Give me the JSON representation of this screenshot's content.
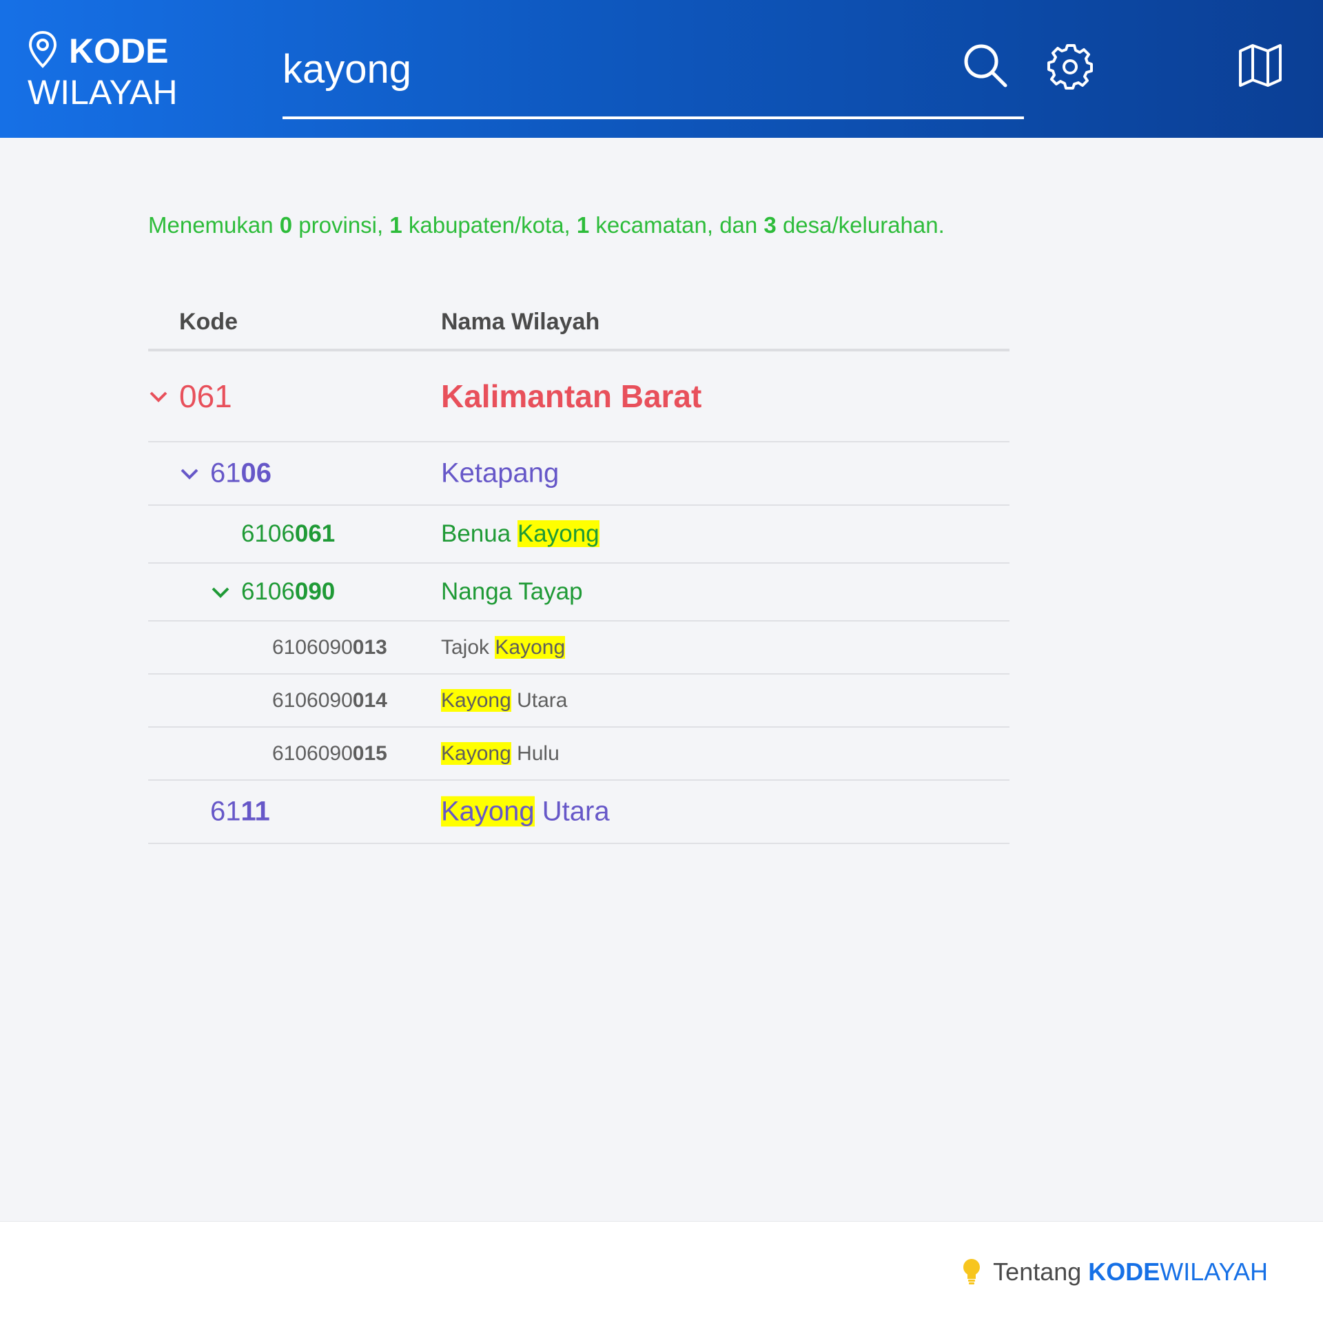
{
  "header": {
    "logo_top": "KODE",
    "logo_bottom": "WILAYAH",
    "search_value": "kayong",
    "icons": {
      "pin": "map-pin-icon",
      "search": "search-icon",
      "settings": "gear-icon",
      "map": "map-icon"
    }
  },
  "summary": {
    "prefix": "Menemukan ",
    "provinsi_count": "0",
    "provinsi_label": " provinsi, ",
    "kabupaten_count": "1",
    "kabupaten_label": " kabupaten/kota, ",
    "kecamatan_count": "1",
    "kecamatan_label": " kecamatan, dan ",
    "desa_count": "3",
    "desa_label": " desa/kelurahan."
  },
  "table": {
    "columns": [
      "Kode",
      "Nama Wilayah"
    ],
    "rows": [
      {
        "code_prefix": "0",
        "code_suffix": "61",
        "name_before": "Kalimantan Barat",
        "name_hl": "",
        "name_after": ""
      },
      {
        "code_prefix": "61",
        "code_suffix": "06",
        "name_before": "Ketapang",
        "name_hl": "",
        "name_after": ""
      },
      {
        "code_prefix": "6106",
        "code_suffix": "061",
        "name_before": "Benua ",
        "name_hl": "Kayong",
        "name_after": ""
      },
      {
        "code_prefix": "6106",
        "code_suffix": "090",
        "name_before": "Nanga Tayap",
        "name_hl": "",
        "name_after": ""
      },
      {
        "code_prefix": "6106090",
        "code_suffix": "013",
        "name_before": "Tajok ",
        "name_hl": "Kayong",
        "name_after": ""
      },
      {
        "code_prefix": "6106090",
        "code_suffix": "014",
        "name_before": "",
        "name_hl": "Kayong",
        "name_after": " Utara"
      },
      {
        "code_prefix": "6106090",
        "code_suffix": "015",
        "name_before": "",
        "name_hl": "Kayong",
        "name_after": " Hulu"
      },
      {
        "code_prefix": "61",
        "code_suffix": "11",
        "name_before": "",
        "name_hl": "Kayong",
        "name_after": " Utara"
      }
    ]
  },
  "footer": {
    "link_text": "Tentang ",
    "brand_bold": "KODE",
    "brand_light": "WILAYAH",
    "icon": "lightbulb-icon"
  },
  "colors": {
    "header_start": "#1670e6",
    "header_end": "#0b3f95",
    "province": "#e8505b",
    "regency": "#6657c8",
    "district": "#1f9a36",
    "village": "#5e5e5e",
    "summary": "#2dbc3a",
    "highlight": "#ffff00"
  }
}
